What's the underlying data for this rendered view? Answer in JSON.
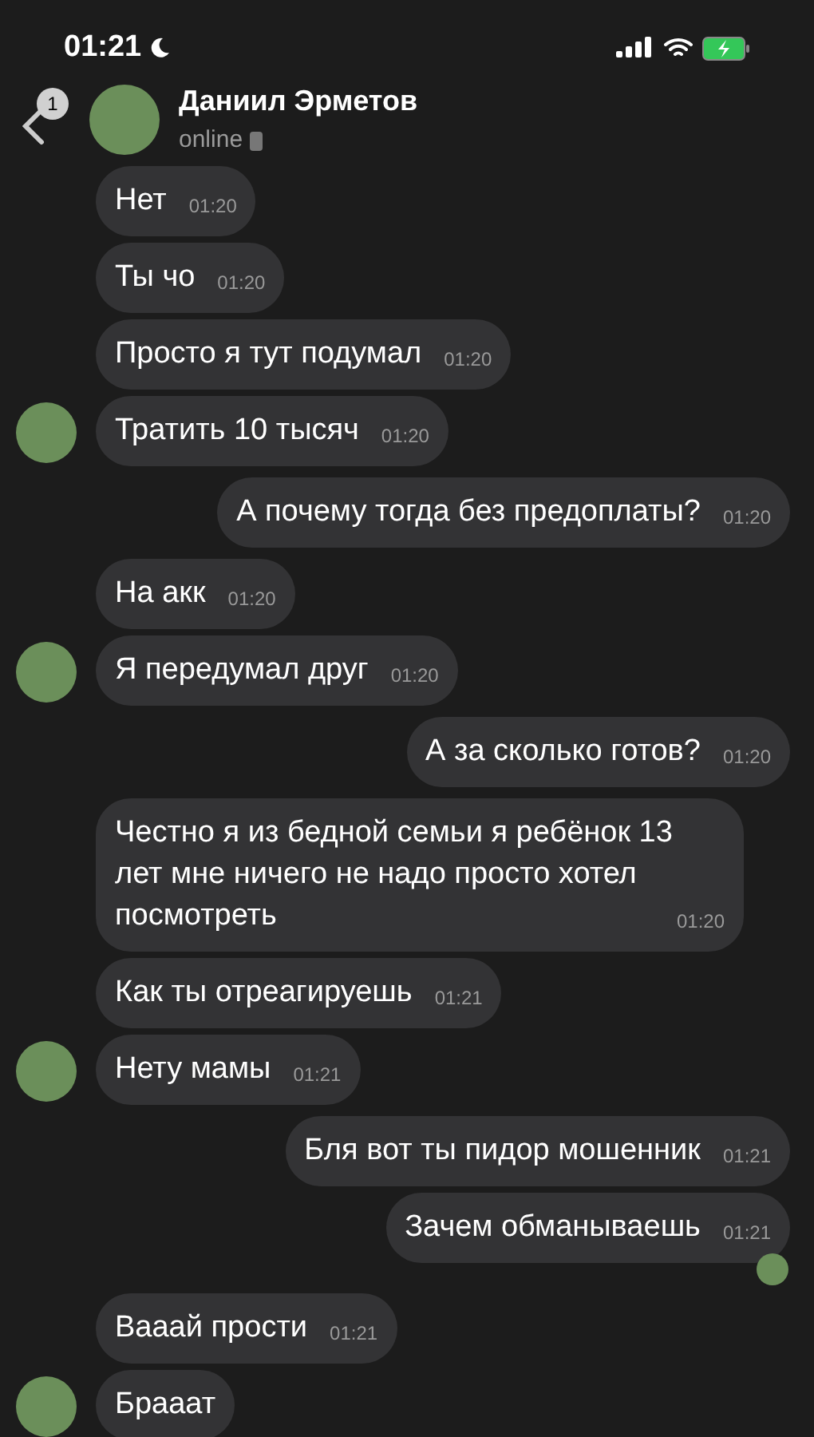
{
  "status_bar": {
    "time": "01:21"
  },
  "header": {
    "back_badge": "1",
    "name": "Даниил Эрметов",
    "status": "online"
  },
  "messages": [
    {
      "kind": "in",
      "text": "Нет",
      "time": "01:20",
      "avatar": false
    },
    {
      "kind": "in",
      "text": "Ты чо",
      "time": "01:20",
      "avatar": false
    },
    {
      "kind": "in",
      "text": "Просто я тут подумал",
      "time": "01:20",
      "avatar": false
    },
    {
      "kind": "in",
      "text": "Тратить 10 тысяч",
      "time": "01:20",
      "avatar": true
    },
    {
      "kind": "out",
      "text": "А почему тогда без предоплаты?",
      "time": "01:20",
      "avatar": false
    },
    {
      "kind": "in",
      "text": "На акк",
      "time": "01:20",
      "avatar": false
    },
    {
      "kind": "in",
      "text": "Я передумал друг",
      "time": "01:20",
      "avatar": true
    },
    {
      "kind": "out",
      "text": "А за сколько готов?",
      "time": "01:20",
      "avatar": false
    },
    {
      "kind": "in",
      "text": "Честно я из бедной семьи я ребёнок 13 лет мне ничего не надо просто хотел посмотреть",
      "time": "01:20",
      "avatar": false
    },
    {
      "kind": "in",
      "text": "Как ты отреагируешь",
      "time": "01:21",
      "avatar": false
    },
    {
      "kind": "in",
      "text": "Нету мамы",
      "time": "01:21",
      "avatar": true
    },
    {
      "kind": "out",
      "text": "Бля вот ты пидор мошенник",
      "time": "01:21",
      "avatar": false
    },
    {
      "kind": "out",
      "text": "Зачем обманываешь",
      "time": "01:21",
      "avatar": true
    },
    {
      "kind": "in",
      "text": "Вааай прости",
      "time": "01:21",
      "avatar": false
    },
    {
      "kind": "in",
      "text": "Брааат",
      "avatar": true
    }
  ]
}
